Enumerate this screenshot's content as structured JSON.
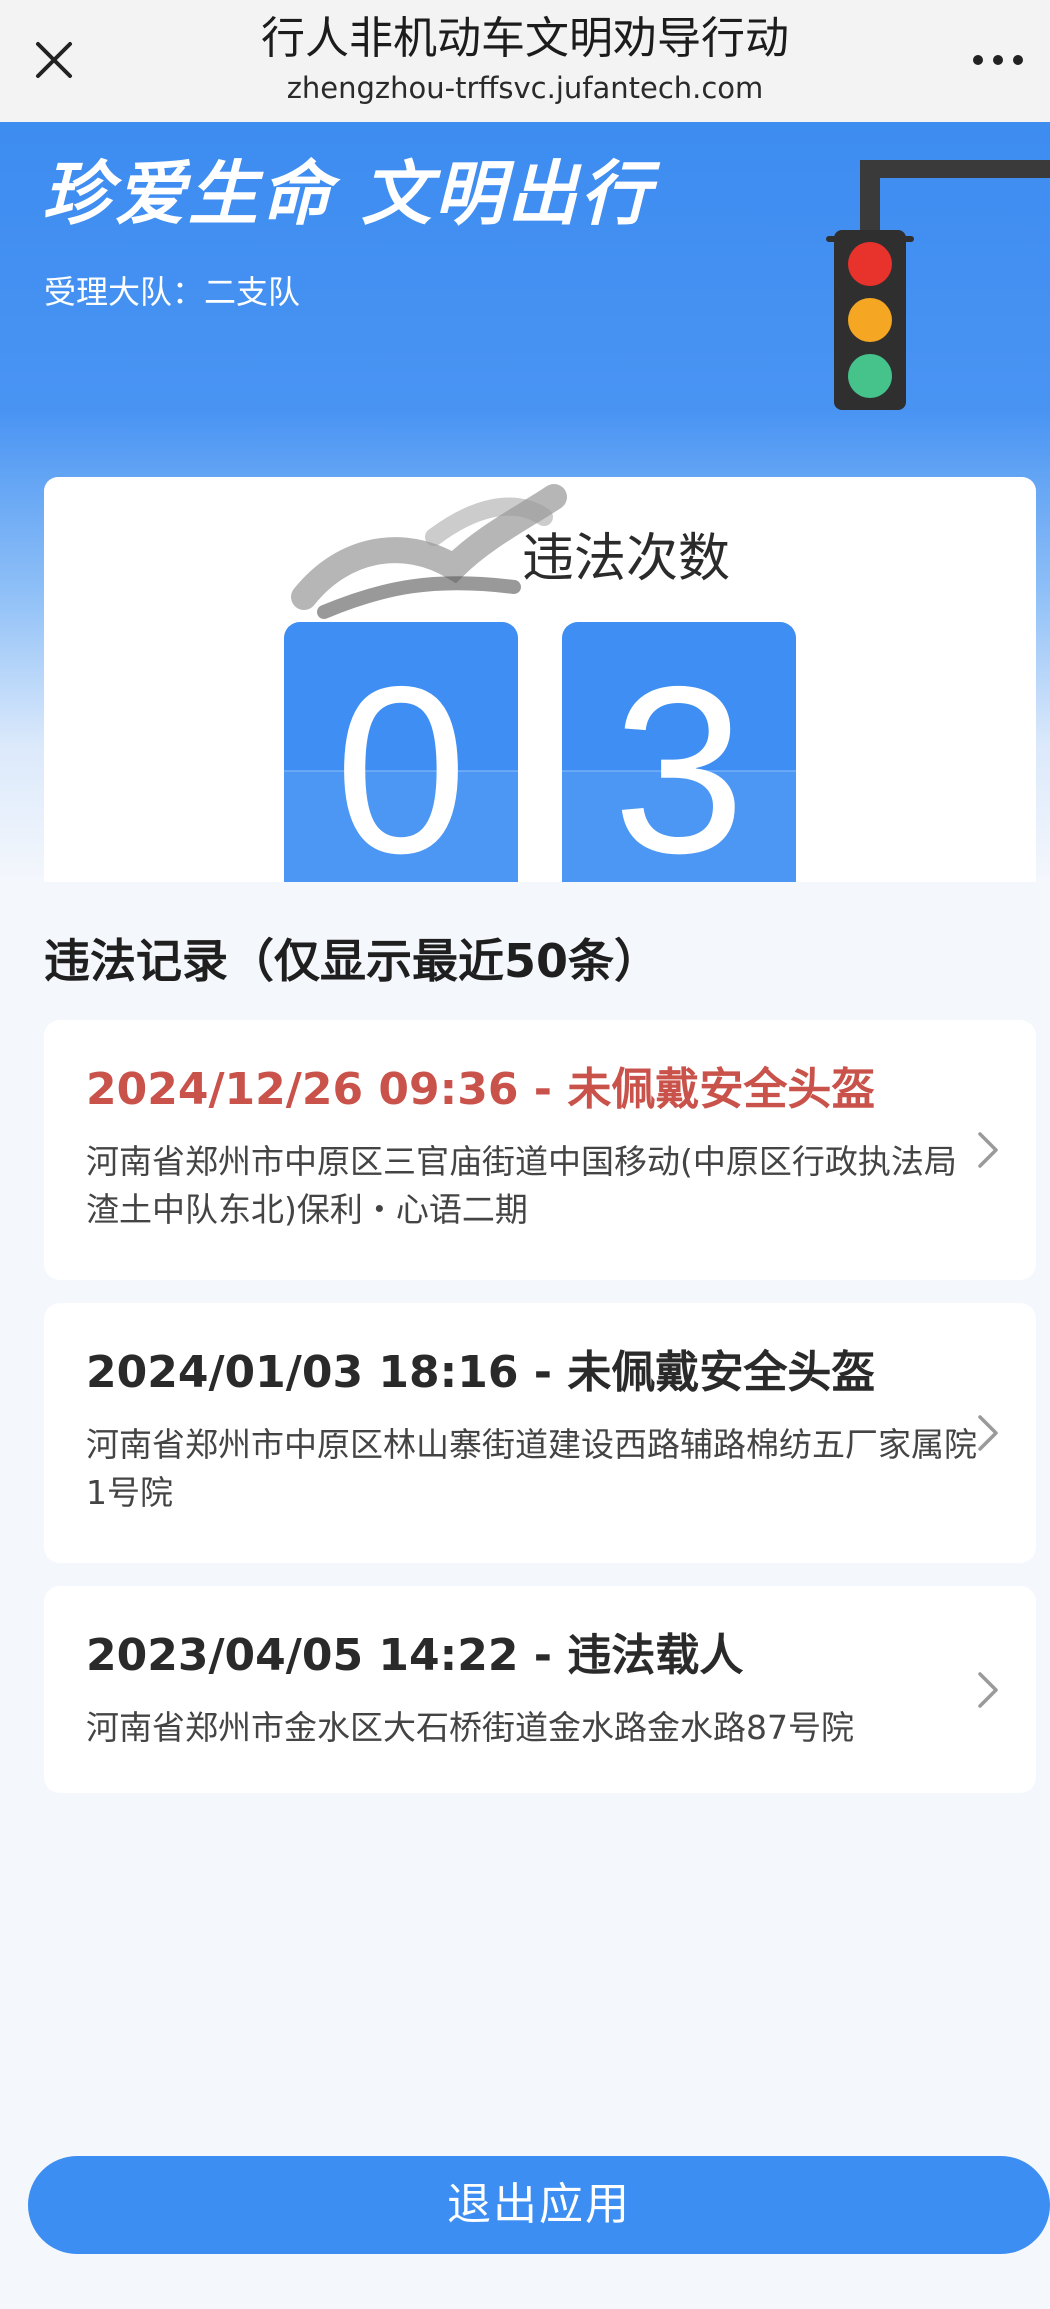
{
  "header": {
    "title": "行人非机动车文明劝导行动",
    "subtitle": "zhengzhou-trffsvc.jufantech.com",
    "close_icon": "close-icon",
    "more_icon": "more-icon"
  },
  "hero": {
    "slogan": "珍爱生命 文明出行",
    "team_line": "受理大队：二支队",
    "traffic_light_icon": "traffic-light-icon"
  },
  "counter": {
    "label": "违法次数",
    "digits": [
      "0",
      "3"
    ]
  },
  "records": {
    "title": "违法记录（仅显示最近50条）",
    "items": [
      {
        "heading": "2024/12/26 09:36 - 未佩戴安全头盔",
        "address": "河南省郑州市中原区三官庙街道中国移动(中原区行政执法局渣土中队东北)保利・心语二期",
        "highlight": true
      },
      {
        "heading": "2024/01/03 18:16 - 未佩戴安全头盔",
        "address": "河南省郑州市中原区林山寨街道建设西路辅路棉纺五厂家属院1号院",
        "highlight": false
      },
      {
        "heading": "2023/04/05 14:22 - 违法载人",
        "address": "河南省郑州市金水区大石桥街道金水路金水路87号院",
        "highlight": false
      }
    ]
  },
  "footer": {
    "exit_label": "退出应用"
  },
  "colors": {
    "brand_blue": "#3c8ef2",
    "highlight_red": "#c9524b",
    "page_bg": "#f4f7fc"
  }
}
